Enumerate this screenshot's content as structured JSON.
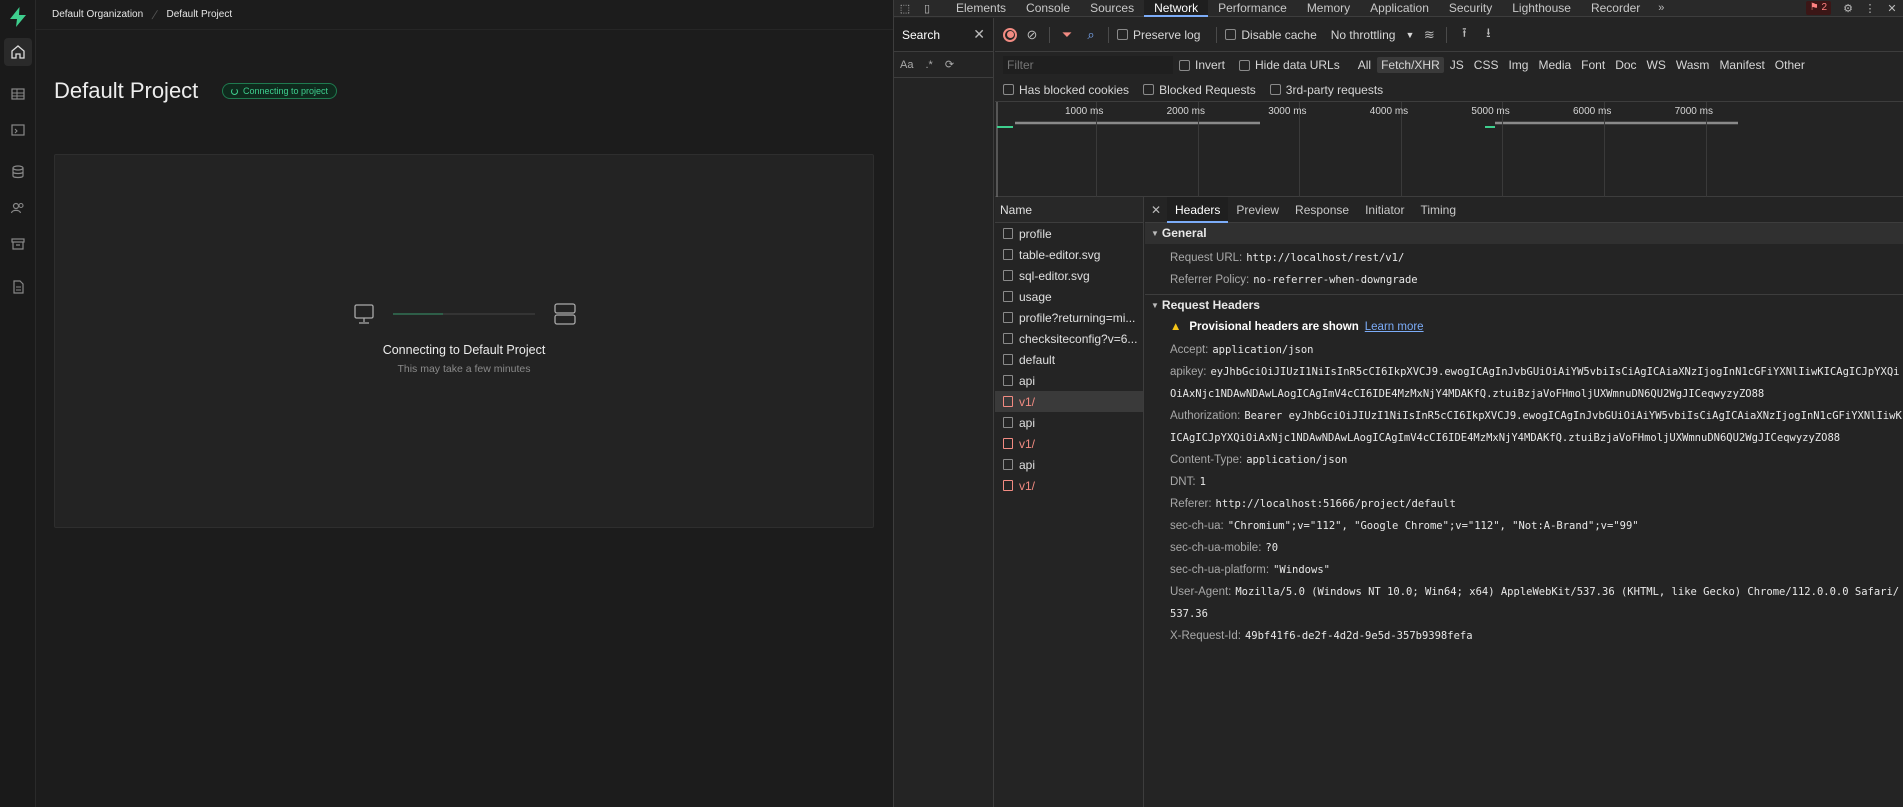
{
  "app": {
    "breadcrumb": {
      "org": "Default Organization",
      "project": "Default Project"
    },
    "page_title": "Default Project",
    "status_pill": "Connecting to project",
    "connect_title": "Connecting to Default Project",
    "connect_subtitle": "This may take a few minutes",
    "accent": "#3ecf8e"
  },
  "devtools": {
    "tabs": [
      "Elements",
      "Console",
      "Sources",
      "Network",
      "Performance",
      "Memory",
      "Application",
      "Security",
      "Lighthouse",
      "Recorder"
    ],
    "active_tab": "Network",
    "issues_count": "2",
    "search_label": "Search",
    "search_tools": {
      "match_case": "Aa",
      "regex": ".*"
    },
    "toolbar": {
      "preserve_log": "Preserve log",
      "disable_cache": "Disable cache",
      "throttling": "No throttling",
      "filter_placeholder": "Filter",
      "invert": "Invert",
      "hide_data_urls": "Hide data URLs",
      "types": [
        "All",
        "Fetch/XHR",
        "JS",
        "CSS",
        "Img",
        "Media",
        "Font",
        "Doc",
        "WS",
        "Wasm",
        "Manifest",
        "Other"
      ],
      "active_type": "Fetch/XHR",
      "has_blocked_cookies": "Has blocked cookies",
      "blocked_requests": "Blocked Requests",
      "third_party": "3rd-party requests"
    },
    "timeline_ticks": [
      "1000 ms",
      "2000 ms",
      "3000 ms",
      "4000 ms",
      "5000 ms",
      "6000 ms",
      "7000 ms"
    ],
    "name_header": "Name",
    "requests": [
      {
        "name": "profile",
        "error": false
      },
      {
        "name": "table-editor.svg",
        "error": false
      },
      {
        "name": "sql-editor.svg",
        "error": false
      },
      {
        "name": "usage",
        "error": false
      },
      {
        "name": "profile?returning=mi...",
        "error": false
      },
      {
        "name": "checksiteconfig?v=6...",
        "error": false
      },
      {
        "name": "default",
        "error": false
      },
      {
        "name": "api",
        "error": false
      },
      {
        "name": "v1/",
        "error": true
      },
      {
        "name": "api",
        "error": false
      },
      {
        "name": "v1/",
        "error": true
      },
      {
        "name": "api",
        "error": false
      },
      {
        "name": "v1/",
        "error": true
      }
    ],
    "detail_tabs": [
      "Headers",
      "Preview",
      "Response",
      "Initiator",
      "Timing"
    ],
    "active_detail_tab": "Headers",
    "general": {
      "title": "General",
      "request_url_key": "Request URL:",
      "request_url": "http://localhost/rest/v1/",
      "referrer_policy_key": "Referrer Policy:",
      "referrer_policy": "no-referrer-when-downgrade"
    },
    "request_headers": {
      "title": "Request Headers",
      "provisional": "Provisional headers are shown",
      "learn_more": "Learn more",
      "items": [
        {
          "k": "Accept:",
          "v": "application/json"
        },
        {
          "k": "apikey:",
          "v": "eyJhbGciOiJIUzI1NiIsInR5cCI6IkpXVCJ9.ewogICAgInJvbGUiOiAiYW5vbiIsCiAgICAiaXNzIjogInN1cGFiYXNlIiwKICAgICJpYXQiOiAxNjc1NDAwNDAwLAogICAgImV4cCI6IDE4MzMxNjY4MDAKfQ.ztuiBzjaVoFHmoljUXWmnuDN6QU2WgJICeqwyzyZO88"
        },
        {
          "k": "Authorization:",
          "v": "Bearer eyJhbGciOiJIUzI1NiIsInR5cCI6IkpXVCJ9.ewogICAgInJvbGUiOiAiYW5vbiIsCiAgICAiaXNzIjogInN1cGFiYXNlIiwKICAgICJpYXQiOiAxNjc1NDAwNDAwLAogICAgImV4cCI6IDE4MzMxNjY4MDAKfQ.ztuiBzjaVoFHmoljUXWmnuDN6QU2WgJICeqwyzyZO88"
        },
        {
          "k": "Content-Type:",
          "v": "application/json"
        },
        {
          "k": "DNT:",
          "v": "1"
        },
        {
          "k": "Referer:",
          "v": "http://localhost:51666/project/default"
        },
        {
          "k": "sec-ch-ua:",
          "v": "\"Chromium\";v=\"112\", \"Google Chrome\";v=\"112\", \"Not:A-Brand\";v=\"99\""
        },
        {
          "k": "sec-ch-ua-mobile:",
          "v": "?0"
        },
        {
          "k": "sec-ch-ua-platform:",
          "v": "\"Windows\""
        },
        {
          "k": "User-Agent:",
          "v": "Mozilla/5.0 (Windows NT 10.0; Win64; x64) AppleWebKit/537.36 (KHTML, like Gecko) Chrome/112.0.0.0 Safari/537.36"
        },
        {
          "k": "X-Request-Id:",
          "v": "49bf41f6-de2f-4d2d-9e5d-357b9398fefa"
        }
      ]
    }
  }
}
